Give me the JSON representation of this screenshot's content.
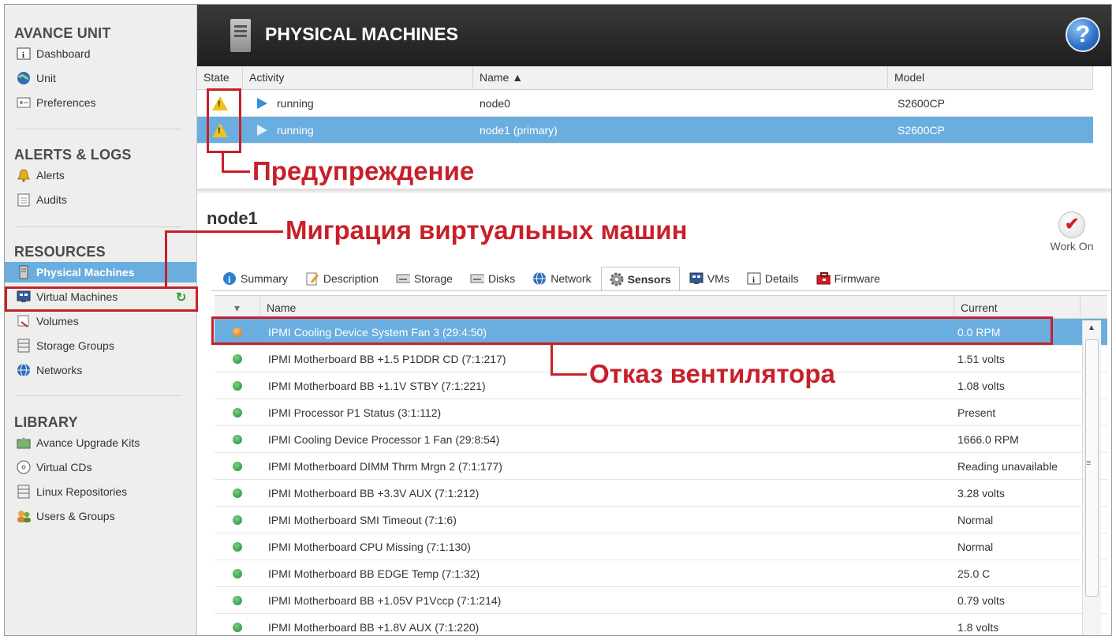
{
  "sidebar": {
    "sections": [
      {
        "title": "AVANCE UNIT",
        "items": [
          {
            "label": "Dashboard",
            "icon": "info-icon"
          },
          {
            "label": "Unit",
            "icon": "globe-icon"
          },
          {
            "label": "Preferences",
            "icon": "preferences-icon"
          }
        ]
      },
      {
        "title": "ALERTS & LOGS",
        "items": [
          {
            "label": "Alerts",
            "icon": "bell-icon"
          },
          {
            "label": "Audits",
            "icon": "audit-icon"
          }
        ]
      },
      {
        "title": "RESOURCES",
        "items": [
          {
            "label": "Physical Machines",
            "icon": "server-icon",
            "active": true
          },
          {
            "label": "Virtual Machines",
            "icon": "monitor-icon"
          },
          {
            "label": "Volumes",
            "icon": "volume-icon"
          },
          {
            "label": "Storage Groups",
            "icon": "storage-icon"
          },
          {
            "label": "Networks",
            "icon": "network-icon"
          }
        ]
      },
      {
        "title": "LIBRARY",
        "items": [
          {
            "label": "Avance Upgrade Kits",
            "icon": "upgrade-icon"
          },
          {
            "label": "Virtual CDs",
            "icon": "cd-icon"
          },
          {
            "label": "Linux Repositories",
            "icon": "repository-icon"
          },
          {
            "label": "Users & Groups",
            "icon": "users-icon"
          }
        ]
      }
    ]
  },
  "header": {
    "title": "PHYSICAL MACHINES",
    "help": "?"
  },
  "machines": {
    "columns": [
      "State",
      "Activity",
      "Name ▲",
      "Model"
    ],
    "rows": [
      {
        "state": "warning",
        "activity": "running",
        "name": "node0",
        "model": "S2600CP"
      },
      {
        "state": "warning",
        "activity": "running",
        "name": "node1 (primary)",
        "model": "S2600CP",
        "selected": true
      }
    ]
  },
  "node": {
    "title": "node1",
    "work_on": "Work On"
  },
  "tabs": [
    "Summary",
    "Description",
    "Storage",
    "Disks",
    "Network",
    "Sensors",
    "VMs",
    "Details",
    "Firmware"
  ],
  "active_tab": "Sensors",
  "sensors": {
    "columns": [
      "Name",
      "Current"
    ],
    "rows": [
      {
        "name": "IPMI Cooling Device System Fan 3 (29:4:50)",
        "current": "0.0 RPM",
        "status": "fault"
      },
      {
        "name": "IPMI Motherboard BB +1.5 P1DDR CD (7:1:217)",
        "current": "1.51 volts",
        "status": "ok"
      },
      {
        "name": "IPMI Motherboard BB +1.1V STBY (7:1:221)",
        "current": "1.08 volts",
        "status": "ok"
      },
      {
        "name": "IPMI Processor P1 Status (3:1:112)",
        "current": "Present",
        "status": "ok"
      },
      {
        "name": "IPMI Cooling Device Processor 1 Fan (29:8:54)",
        "current": "1666.0 RPM",
        "status": "ok"
      },
      {
        "name": "IPMI Motherboard DIMM Thrm Mrgn 2 (7:1:177)",
        "current": "Reading unavailable",
        "status": "ok"
      },
      {
        "name": "IPMI Motherboard BB +3.3V AUX (7:1:212)",
        "current": "3.28 volts",
        "status": "ok"
      },
      {
        "name": "IPMI Motherboard SMI Timeout (7:1:6)",
        "current": "Normal",
        "status": "ok"
      },
      {
        "name": "IPMI Motherboard CPU Missing (7:1:130)",
        "current": "Normal",
        "status": "ok"
      },
      {
        "name": "IPMI Motherboard BB EDGE Temp (7:1:32)",
        "current": "25.0 C",
        "status": "ok"
      },
      {
        "name": "IPMI Motherboard BB +1.05V P1Vccp (7:1:214)",
        "current": "0.79 volts",
        "status": "ok"
      },
      {
        "name": "IPMI Motherboard BB +1.8V AUX (7:1:220)",
        "current": "1.8 volts",
        "status": "ok"
      }
    ]
  },
  "annotations": {
    "warning": "Предупреждение",
    "migration": "Миграция виртуальных машин",
    "fan_failure": "Отказ вентилятора"
  },
  "colors": {
    "selection": "#6aaee0",
    "annotation": "#c8202a",
    "header": "#2a2a2a"
  }
}
